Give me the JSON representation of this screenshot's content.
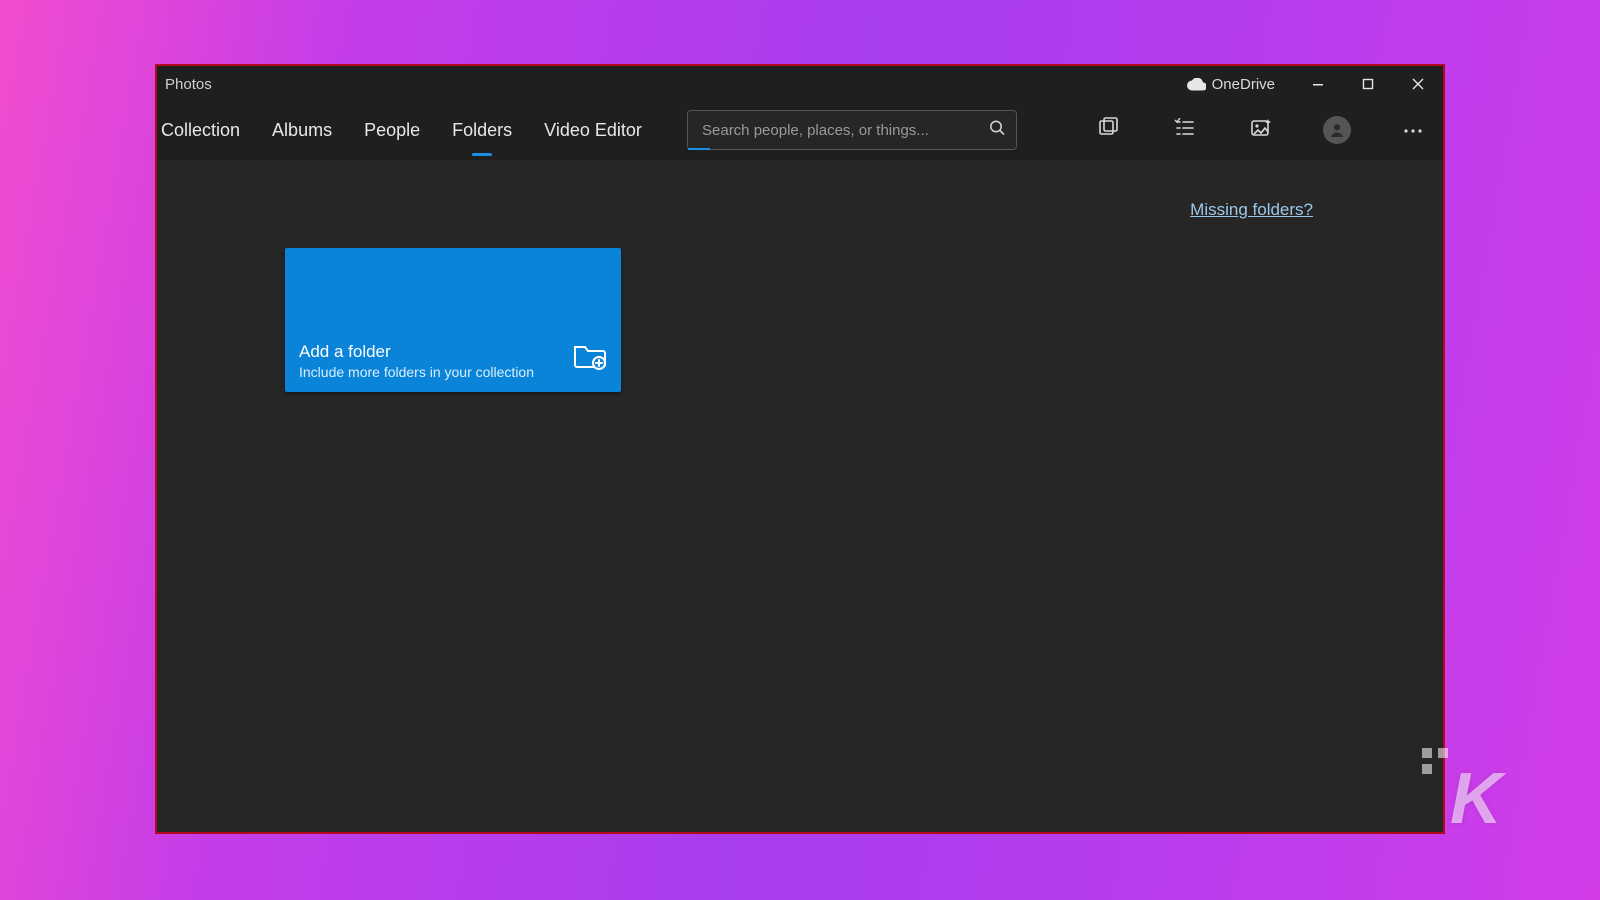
{
  "window": {
    "title": "Photos"
  },
  "titlebar": {
    "onedrive_label": "OneDrive"
  },
  "tabs": {
    "items": [
      {
        "label": "Collection",
        "active": false
      },
      {
        "label": "Albums",
        "active": false
      },
      {
        "label": "People",
        "active": false
      },
      {
        "label": "Folders",
        "active": true
      },
      {
        "label": "Video Editor",
        "active": false
      }
    ]
  },
  "search": {
    "placeholder": "Search people, places, or things..."
  },
  "content": {
    "missing_folders_link": "Missing folders?",
    "add_folder": {
      "title": "Add a folder",
      "subtitle": "Include more folders in your collection"
    }
  },
  "colors": {
    "accent": "#0a84d8",
    "window_bg": "#1f1f1f",
    "content_bg": "#262626",
    "border": "#b2091f"
  }
}
